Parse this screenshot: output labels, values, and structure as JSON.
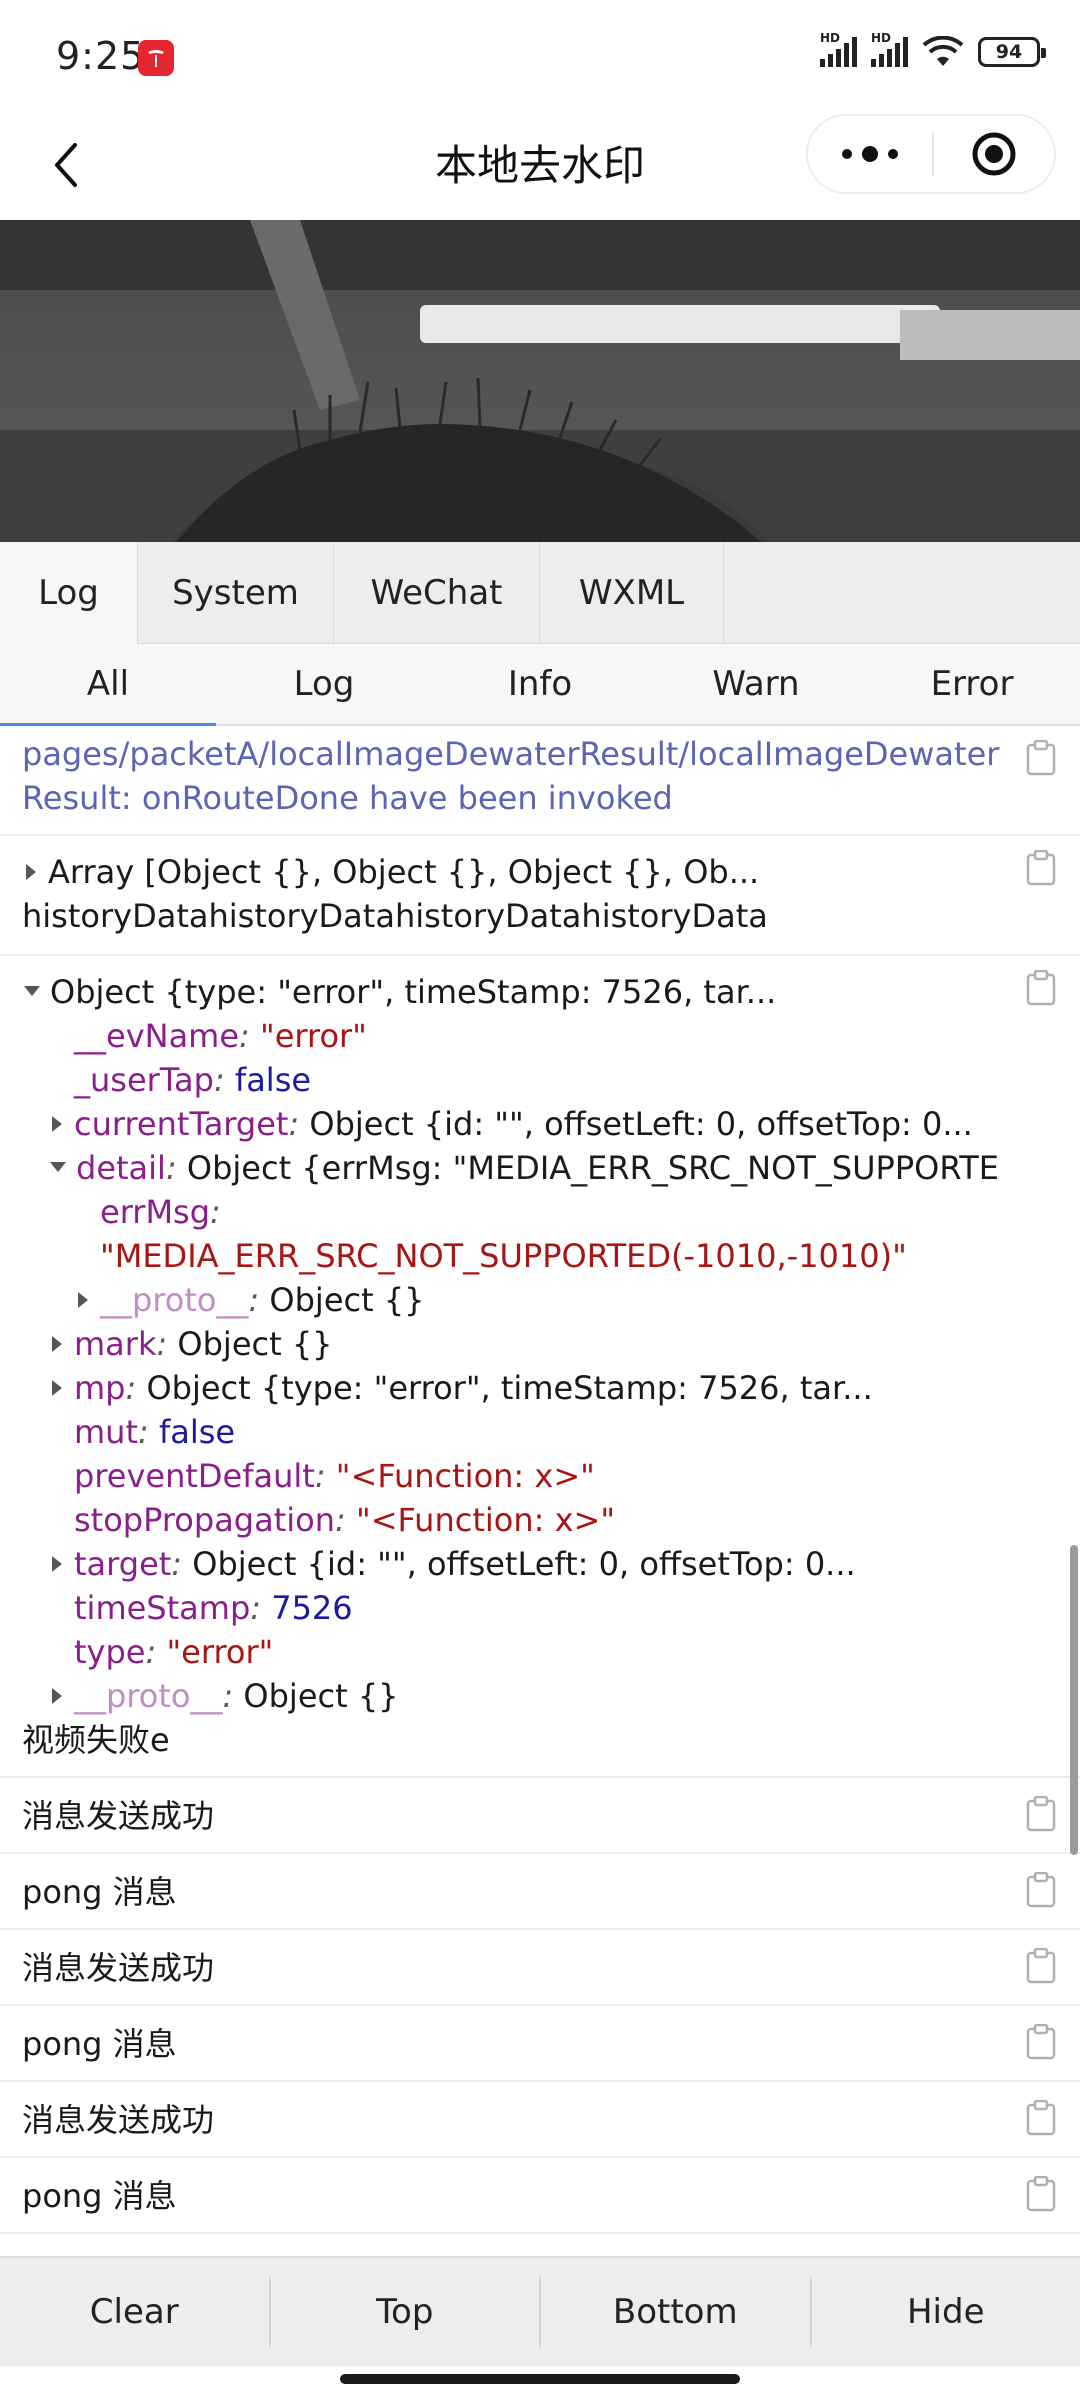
{
  "status": {
    "time": "9:25",
    "battery": "94",
    "network1": "HD",
    "network2": "HD"
  },
  "nav": {
    "title": "本地去水印"
  },
  "tabs": [
    "Log",
    "System",
    "WeChat",
    "WXML"
  ],
  "subtabs": [
    "All",
    "Log",
    "Info",
    "Warn",
    "Error"
  ],
  "log": {
    "route": "pages/packetA/localImageDewaterResult/localImageDewaterResult: onRouteDone have been invoked",
    "array_line": "Array [Object {}, Object {}, Object {}, Ob...",
    "array_text": "historyDatahistoryDatahistoryDatahistoryData",
    "obj": {
      "head": "Object {type: \"error\", timeStamp: 7526, tar...",
      "evName_k": "__evName",
      "evName_v": "\"error\"",
      "userTap_k": "_userTap",
      "userTap_v": "false",
      "currentTarget_k": "currentTarget",
      "currentTarget_v": "Object {id: \"\", offsetLeft: 0, offsetTop: 0...",
      "detail_k": "detail",
      "detail_v": "Object {errMsg: \"MEDIA_ERR_SRC_NOT_SUPPORTE...",
      "errMsg_k": "errMsg",
      "errMsg_v": "\"MEDIA_ERR_SRC_NOT_SUPPORTED(-1010,-1010)\"",
      "proto1_k": "__proto__",
      "proto1_v": "Object {}",
      "mark_k": "mark",
      "mark_v": "Object {}",
      "mp_k": "mp",
      "mp_v": "Object {type: \"error\", timeStamp: 7526, tar...",
      "mut_k": "mut",
      "mut_v": "false",
      "preventDefault_k": "preventDefault",
      "preventDefault_v": "\"<Function: x>\"",
      "stopPropagation_k": "stopPropagation",
      "stopPropagation_v": "\"<Function: x>\"",
      "target_k": "target",
      "target_v": "Object {id: \"\", offsetLeft: 0, offsetTop: 0...",
      "timeStamp_k": "timeStamp",
      "timeStamp_v": "7526",
      "type_k": "type",
      "type_v": "\"error\"",
      "proto2_k": "__proto__",
      "proto2_v": "Object {}",
      "tail": "视频失败e"
    },
    "messages": [
      "消息发送成功",
      "pong 消息",
      "消息发送成功",
      "pong 消息",
      "消息发送成功",
      "pong 消息"
    ]
  },
  "toolbar": {
    "clear": "Clear",
    "top": "Top",
    "bottom": "Bottom",
    "hide": "Hide"
  },
  "colors": {
    "accent": "#4a90e2",
    "route_text": "#5b65b3",
    "key": "#8a1f8c",
    "string": "#a81515",
    "number": "#1c1aa3",
    "tesla": "#e3262f"
  },
  "icons": {
    "back": "chevron-left-icon",
    "more": "more-dots-icon",
    "close": "target-circle-icon",
    "copy": "clipboard-icon"
  }
}
